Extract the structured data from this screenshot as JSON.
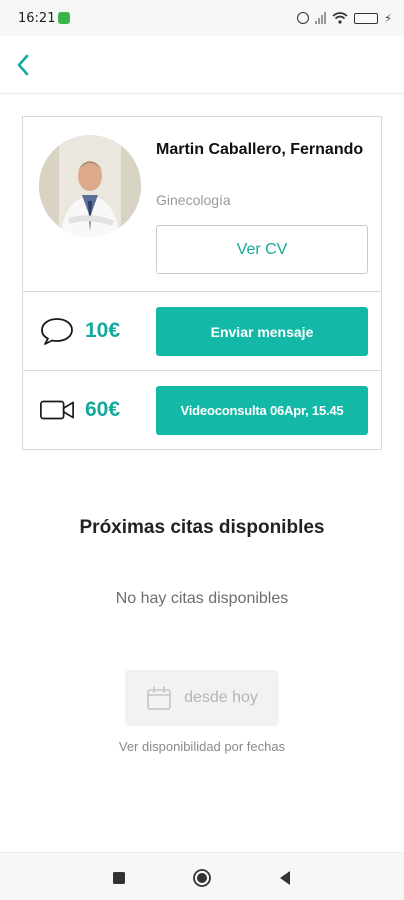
{
  "status_bar": {
    "time": "16:21",
    "battery": "100"
  },
  "doctor": {
    "name": "Martin Caballero, Fernando",
    "specialty": "Ginecología",
    "cv_button_label": "Ver CV"
  },
  "services": [
    {
      "icon": "chat-bubble-icon",
      "price": "10€",
      "button_label": "Enviar mensaje"
    },
    {
      "icon": "video-camera-icon",
      "price": "60€",
      "button_label": "Videoconsulta 06Apr, 15.45"
    }
  ],
  "availability": {
    "title": "Próximas citas disponibles",
    "empty_message": "No hay citas disponibles",
    "date_button_label": "desde hoy",
    "date_hint": "Ver disponibilidad por fechas"
  },
  "colors": {
    "accent": "#14b8a6",
    "accent_text": "#14a99d"
  }
}
